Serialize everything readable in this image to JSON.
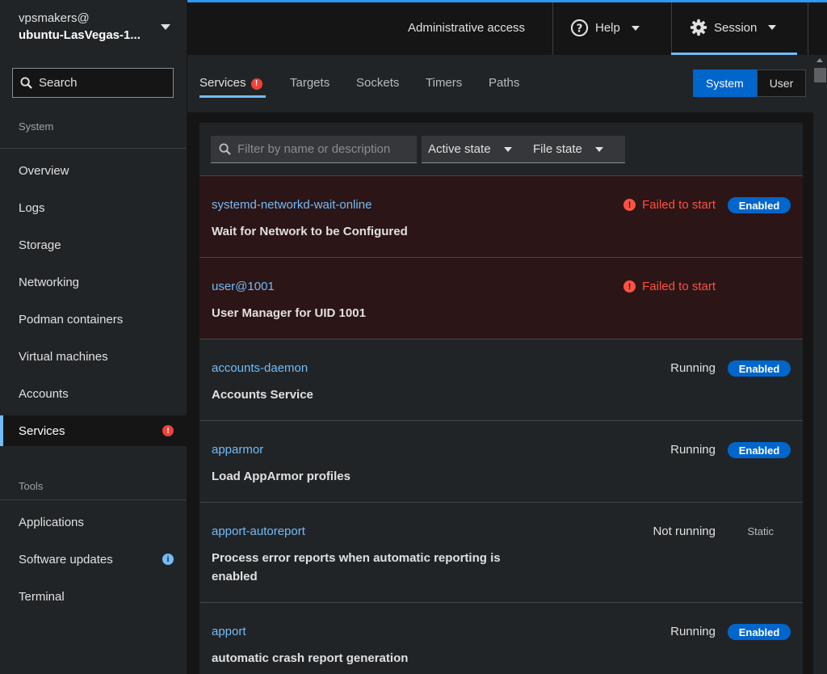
{
  "sidebar": {
    "host_user": "vpsmakers@",
    "host_name": "ubuntu-LasVegas-1...",
    "search_label": "Search",
    "system_label": "System",
    "system_items": [
      {
        "label": "Overview"
      },
      {
        "label": "Logs"
      },
      {
        "label": "Storage"
      },
      {
        "label": "Networking"
      },
      {
        "label": "Podman containers"
      },
      {
        "label": "Virtual machines"
      },
      {
        "label": "Accounts"
      },
      {
        "label": "Services",
        "active": true,
        "badge": "!"
      }
    ],
    "tools_label": "Tools",
    "tools_items": [
      {
        "label": "Applications"
      },
      {
        "label": "Software updates",
        "badge": "i"
      },
      {
        "label": "Terminal"
      }
    ]
  },
  "topbar": {
    "admin_access": "Administrative access",
    "help_label": "Help",
    "session_label": "Session"
  },
  "tabs": {
    "items": [
      "Services",
      "Targets",
      "Sockets",
      "Timers",
      "Paths"
    ],
    "services_badge": "!",
    "toggle": {
      "system": "System",
      "user": "User",
      "selected": "System"
    }
  },
  "filters": {
    "placeholder": "Filter by name or description",
    "active_state": "Active state",
    "file_state": "File state"
  },
  "colors": {
    "accent": "#73bcf7",
    "primary_blue": "#0066cc",
    "danger": "#fe5142",
    "failed_row_bg": "#2c1516"
  },
  "services": [
    {
      "unit": "systemd-networkd-wait-online",
      "description": "Wait for Network to be Configured",
      "state": "Failed to start",
      "file_state": "Enabled",
      "failed": true
    },
    {
      "unit": "user@1001",
      "description": "User Manager for UID 1001",
      "state": "Failed to start",
      "file_state": "",
      "failed": true
    },
    {
      "unit": "accounts-daemon",
      "description": "Accounts Service",
      "state": "Running",
      "file_state": "Enabled",
      "failed": false
    },
    {
      "unit": "apparmor",
      "description": "Load AppArmor profiles",
      "state": "Running",
      "file_state": "Enabled",
      "failed": false
    },
    {
      "unit": "apport-autoreport",
      "description": "Process error reports when automatic reporting is enabled",
      "state": "Not running",
      "file_state": "Static",
      "failed": false
    },
    {
      "unit": "apport",
      "description": "automatic crash report generation",
      "state": "Running",
      "file_state": "Enabled",
      "failed": false
    }
  ]
}
